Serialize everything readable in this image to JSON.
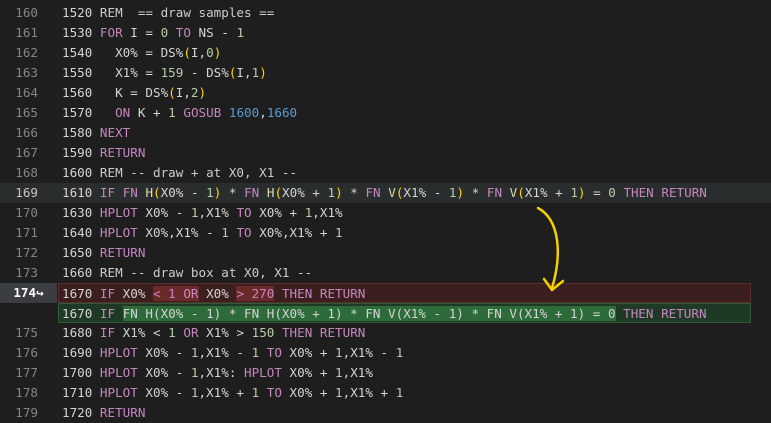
{
  "lines": [
    {
      "num": "160",
      "code": [
        [
          "t",
          "1520 "
        ],
        [
          "rem",
          "REM  == draw samples =="
        ]
      ]
    },
    {
      "num": "161",
      "code": [
        [
          "t",
          "1530 "
        ],
        [
          "k",
          "FOR"
        ],
        [
          "t",
          " I = "
        ],
        [
          "n",
          "0"
        ],
        [
          "t",
          " "
        ],
        [
          "k",
          "TO"
        ],
        [
          "t",
          " NS - "
        ],
        [
          "n",
          "1"
        ]
      ]
    },
    {
      "num": "162",
      "code": [
        [
          "t",
          "1540   X0% = DS%"
        ],
        [
          "p",
          "("
        ],
        [
          "t",
          "I,"
        ],
        [
          "n",
          "0"
        ],
        [
          "p",
          ")"
        ]
      ]
    },
    {
      "num": "163",
      "code": [
        [
          "t",
          "1550   X1% = "
        ],
        [
          "n",
          "159"
        ],
        [
          "t",
          " - DS%"
        ],
        [
          "p",
          "("
        ],
        [
          "t",
          "I,"
        ],
        [
          "n",
          "1"
        ],
        [
          "p",
          ")"
        ]
      ]
    },
    {
      "num": "164",
      "code": [
        [
          "t",
          "1560   K = DS%"
        ],
        [
          "p",
          "("
        ],
        [
          "t",
          "I,"
        ],
        [
          "n",
          "2"
        ],
        [
          "p",
          ")"
        ]
      ]
    },
    {
      "num": "165",
      "code": [
        [
          "t",
          "1570   "
        ],
        [
          "k",
          "ON"
        ],
        [
          "t",
          " K + "
        ],
        [
          "n",
          "1"
        ],
        [
          "t",
          " "
        ],
        [
          "k",
          "GOSUB"
        ],
        [
          "t",
          " "
        ],
        [
          "l",
          "1600"
        ],
        [
          "t",
          ","
        ],
        [
          "l",
          "1660"
        ]
      ]
    },
    {
      "num": "166",
      "code": [
        [
          "t",
          "1580 "
        ],
        [
          "k",
          "NEXT"
        ]
      ]
    },
    {
      "num": "167",
      "code": [
        [
          "t",
          "1590 "
        ],
        [
          "k",
          "RETURN"
        ]
      ]
    },
    {
      "num": "168",
      "code": [
        [
          "t",
          "1600 "
        ],
        [
          "rem",
          "REM -- draw + at X0, X1 --"
        ]
      ]
    },
    {
      "num": "169",
      "active": true,
      "cls": "highlight",
      "code": [
        [
          "t",
          "1610 "
        ],
        [
          "k",
          "IF"
        ],
        [
          "t",
          " "
        ],
        [
          "k",
          "FN"
        ],
        [
          "t",
          " "
        ],
        [
          "f",
          "H"
        ],
        [
          "p",
          "("
        ],
        [
          "t",
          "X0% - "
        ],
        [
          "n",
          "1"
        ],
        [
          "p",
          ")"
        ],
        [
          "t",
          " * "
        ],
        [
          "k",
          "FN"
        ],
        [
          "t",
          " "
        ],
        [
          "f",
          "H"
        ],
        [
          "p",
          "("
        ],
        [
          "t",
          "X0% + "
        ],
        [
          "n",
          "1"
        ],
        [
          "p",
          ")"
        ],
        [
          "t",
          " * "
        ],
        [
          "k",
          "FN"
        ],
        [
          "t",
          " "
        ],
        [
          "f",
          "V"
        ],
        [
          "p",
          "("
        ],
        [
          "t",
          "X1% - "
        ],
        [
          "n",
          "1"
        ],
        [
          "p",
          ")"
        ],
        [
          "t",
          " * "
        ],
        [
          "k",
          "FN"
        ],
        [
          "t",
          " "
        ],
        [
          "f",
          "V"
        ],
        [
          "p",
          "("
        ],
        [
          "t",
          "X1% + "
        ],
        [
          "n",
          "1"
        ],
        [
          "p",
          ")"
        ],
        [
          "t",
          " = "
        ],
        [
          "n",
          "0"
        ],
        [
          "t",
          " "
        ],
        [
          "k",
          "THEN"
        ],
        [
          "t",
          " "
        ],
        [
          "k",
          "RETURN"
        ]
      ]
    },
    {
      "num": "170",
      "code": [
        [
          "t",
          "1630 "
        ],
        [
          "k",
          "HPLOT"
        ],
        [
          "t",
          " X0% - "
        ],
        [
          "n",
          "1"
        ],
        [
          "t",
          ",X1% "
        ],
        [
          "k",
          "TO"
        ],
        [
          "t",
          " X0% + "
        ],
        [
          "n",
          "1"
        ],
        [
          "t",
          ",X1%"
        ]
      ]
    },
    {
      "num": "171",
      "code": [
        [
          "t",
          "1640 "
        ],
        [
          "k",
          "HPLOT"
        ],
        [
          "t",
          " X0%,X1% - "
        ],
        [
          "n",
          "1"
        ],
        [
          "t",
          " "
        ],
        [
          "k",
          "TO"
        ],
        [
          "t",
          " X0%,X1% + "
        ],
        [
          "n",
          "1"
        ]
      ]
    },
    {
      "num": "172",
      "code": [
        [
          "t",
          "1650 "
        ],
        [
          "k",
          "RETURN"
        ]
      ]
    },
    {
      "num": "173",
      "code": [
        [
          "t",
          "1660 "
        ],
        [
          "rem",
          "REM -- draw box at X0, X1 --"
        ]
      ]
    },
    {
      "num": "",
      "cls": "diff-del",
      "code": [
        [
          "t",
          "1670 "
        ],
        [
          "k",
          "IF"
        ],
        [
          "t",
          " X0% "
        ],
        [
          "k hl-del",
          "< 1 OR"
        ],
        [
          "t",
          " X0% "
        ],
        [
          "k hl-del",
          "> 270"
        ],
        [
          "t",
          " "
        ],
        [
          "k",
          "THEN"
        ],
        [
          "t",
          " "
        ],
        [
          "k",
          "RETURN"
        ]
      ]
    },
    {
      "num": "",
      "cls": "diff-add",
      "code": [
        [
          "t",
          "1670 "
        ],
        [
          "k",
          "IF"
        ],
        [
          "t",
          " "
        ],
        [
          "t hl-add",
          "FN H(X0% - 1) * FN H(X0% + 1) * FN V(X1% - 1) * FN V(X1% + 1) = 0"
        ],
        [
          "t",
          " "
        ],
        [
          "k",
          "THEN"
        ],
        [
          "t",
          " "
        ],
        [
          "k",
          "RETURN"
        ]
      ]
    },
    {
      "num": "175",
      "code": [
        [
          "t",
          "1680 "
        ],
        [
          "k",
          "IF"
        ],
        [
          "t",
          " X1% < "
        ],
        [
          "n",
          "1"
        ],
        [
          "t",
          " "
        ],
        [
          "k",
          "OR"
        ],
        [
          "t",
          " X1% > "
        ],
        [
          "n",
          "150"
        ],
        [
          "t",
          " "
        ],
        [
          "k",
          "THEN"
        ],
        [
          "t",
          " "
        ],
        [
          "k",
          "RETURN"
        ]
      ]
    },
    {
      "num": "176",
      "code": [
        [
          "t",
          "1690 "
        ],
        [
          "k",
          "HPLOT"
        ],
        [
          "t",
          " X0% - "
        ],
        [
          "n",
          "1"
        ],
        [
          "t",
          ",X1% - "
        ],
        [
          "n",
          "1"
        ],
        [
          "t",
          " "
        ],
        [
          "k",
          "TO"
        ],
        [
          "t",
          " X0% + "
        ],
        [
          "n",
          "1"
        ],
        [
          "t",
          ",X1% - "
        ],
        [
          "n",
          "1"
        ]
      ]
    },
    {
      "num": "177",
      "code": [
        [
          "t",
          "1700 "
        ],
        [
          "k",
          "HPLOT"
        ],
        [
          "t",
          " X0% - "
        ],
        [
          "n",
          "1"
        ],
        [
          "t",
          ",X1%: "
        ],
        [
          "k",
          "HPLOT"
        ],
        [
          "t",
          " X0% + "
        ],
        [
          "n",
          "1"
        ],
        [
          "t",
          ",X1%"
        ]
      ]
    },
    {
      "num": "178",
      "code": [
        [
          "t",
          "1710 "
        ],
        [
          "k",
          "HPLOT"
        ],
        [
          "t",
          " X0% - "
        ],
        [
          "n",
          "1"
        ],
        [
          "t",
          ",X1% + "
        ],
        [
          "n",
          "1"
        ],
        [
          "t",
          " "
        ],
        [
          "k",
          "TO"
        ],
        [
          "t",
          " X0% + "
        ],
        [
          "n",
          "1"
        ],
        [
          "t",
          ",X1% + "
        ],
        [
          "n",
          "1"
        ]
      ]
    },
    {
      "num": "179",
      "code": [
        [
          "t",
          "1720 "
        ],
        [
          "k",
          "RETURN"
        ]
      ]
    }
  ],
  "diff_marker": {
    "line": "174",
    "icon": "wrap-arrow-icon",
    "glyph": "↪"
  },
  "annotation": {
    "icon": "curved-arrow-annotation",
    "color": "#f5d000"
  },
  "colors": {
    "background": "#1e1e1e",
    "keyword": "#c586c0",
    "number": "#b5cea8",
    "line_ref": "#569cd6",
    "func": "#dcdcaa",
    "paren": "#ffd700"
  }
}
